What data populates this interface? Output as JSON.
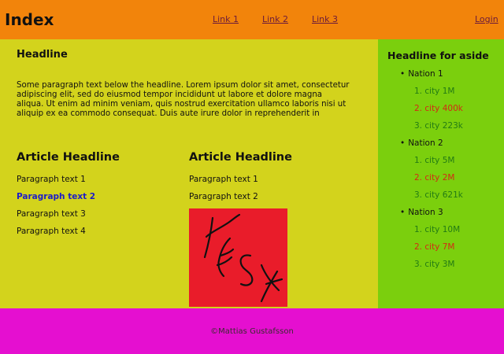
{
  "header": {
    "title": "Index",
    "nav": [
      "Link 1",
      "Link 2",
      "Link 3"
    ],
    "login_label": "Login"
  },
  "main": {
    "headline": "Headline",
    "intro": "Some paragraph text below the headline. Lorem ipsum dolor sit amet, consectetur adipiscing elit, sed do eiusmod tempor incididunt ut labore et dolore magna aliqua. Ut enim ad minim veniam, quis nostrud exercitation ullamco laboris nisi ut aliquip ex ea commodo consequat. Duis aute irure dolor in reprehenderit in",
    "articles": [
      {
        "headline": "Article Headline",
        "paragraphs": [
          "Paragraph text 1",
          "Paragraph text 2",
          "Paragraph text 3",
          "Paragraph text 4"
        ]
      },
      {
        "headline": "Article Headline",
        "paragraphs": [
          "Paragraph text 1",
          "Paragraph text 2"
        ],
        "image_alt": "Test"
      }
    ]
  },
  "aside": {
    "headline": "Headline for aside",
    "nations": [
      {
        "name": "Nation 1",
        "cities": [
          "city 1M",
          "city 400k",
          "city 223k"
        ]
      },
      {
        "name": "Nation 2",
        "cities": [
          "city 5M",
          "city 2M",
          "city 621k"
        ]
      },
      {
        "name": "Nation 3",
        "cities": [
          "city 10M",
          "city 7M",
          "city 3M"
        ]
      }
    ],
    "bullet": "•",
    "ordinals": [
      "1.",
      "2.",
      "3."
    ]
  },
  "footer": {
    "copyright": "©Mattias Gustafsson"
  },
  "colors": {
    "header_bg": "#f2840b",
    "main_bg": "#d3d31c",
    "aside_bg": "#7bcf0d",
    "footer_bg": "#e50fd0",
    "image_bg": "#e91c2a",
    "link_color": "#6a1a3c",
    "highlight_text": "#1c1cc8",
    "city_green": "#237b14",
    "city_red": "#d32a14"
  }
}
